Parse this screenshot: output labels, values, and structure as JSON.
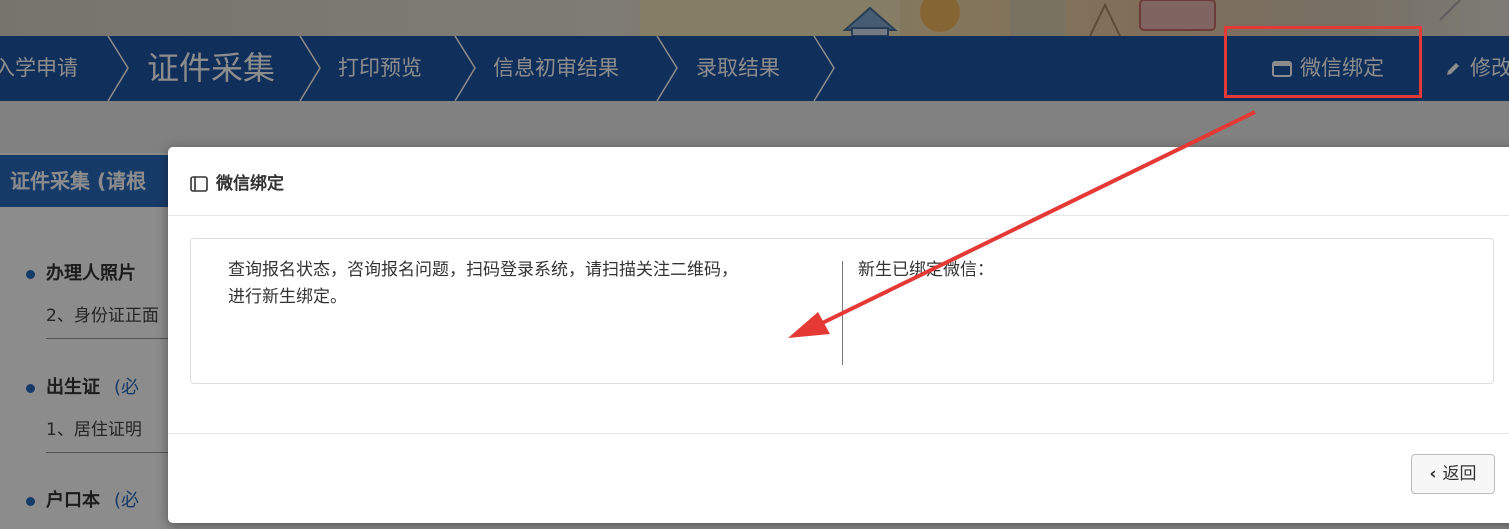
{
  "nav": {
    "steps": [
      "入学申请",
      "证件采集",
      "打印预览",
      "信息初审结果",
      "录取结果"
    ],
    "active_step": "证件采集",
    "wechat_button": "微信绑定",
    "edit_button": "修改"
  },
  "background": {
    "section_title": "证件采集 (请根",
    "items": [
      {
        "label": "办理人照片",
        "required": "",
        "sub": "2、身份证正面"
      },
      {
        "label": "出生证",
        "required": "(必",
        "sub": "1、居住证明"
      },
      {
        "label": "户口本",
        "required": "(必",
        "sub": ""
      }
    ]
  },
  "modal": {
    "title": "微信绑定",
    "left_text_line1": "查询报名状态，咨询报名问题，扫码登录系统，请扫描关注二维码，",
    "left_text_line2": "进行新生绑定。",
    "right_text": "新生已绑定微信：",
    "back_button": "返回"
  },
  "colors": {
    "nav_bg": "#1e57a6",
    "section_bg": "#2a6cc0",
    "highlight": "#e53935",
    "arrow": "#e53935"
  },
  "icons": {
    "wechat": "window-icon",
    "edit": "pencil-icon",
    "back": "chevron-left-icon"
  }
}
